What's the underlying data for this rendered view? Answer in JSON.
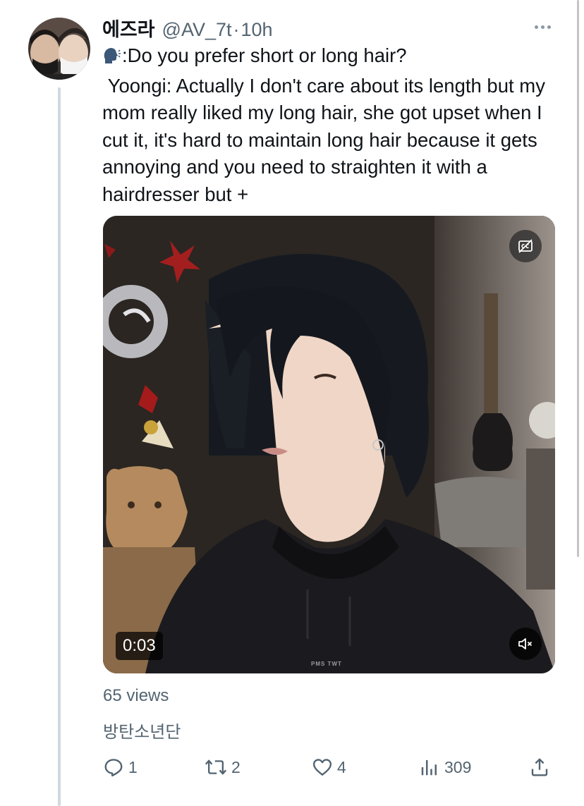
{
  "tweet": {
    "display_name": "에즈라",
    "handle": "@AV_7t",
    "separator": "·",
    "time": "10h",
    "text": ":Do you prefer short or long hair?\n Yoongi: Actually I don't care about its length but my mom really liked my long hair, she got upset when I cut it, it's hard to maintain long hair because it gets annoying and you need to straighten it with a hairdresser but +",
    "emoji": "speaking-head-emoji"
  },
  "media": {
    "type": "video",
    "duration": "0:03",
    "watermark": "PMS TWT",
    "cc_icon": "captions-off-icon",
    "mute_icon": "volume-muted-icon"
  },
  "stats": {
    "views": "65 views",
    "tag": "방탄소년단"
  },
  "actions": {
    "reply_count": "1",
    "retweet_count": "2",
    "like_count": "4",
    "view_count": "309"
  },
  "colors": {
    "text_primary": "#0f1419",
    "text_secondary": "#536471",
    "thread_line": "#cfd9de"
  }
}
